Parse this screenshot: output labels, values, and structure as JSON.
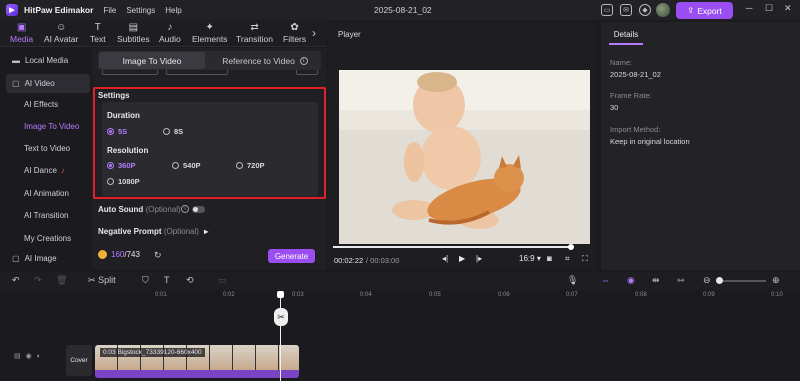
{
  "app": {
    "title": "HitPaw Edimakor",
    "menus": [
      "File",
      "Settings",
      "Help"
    ],
    "project_name": "2025-08-21_02",
    "export_label": "Export"
  },
  "tabs": [
    {
      "label": "Media",
      "icon": "media-icon",
      "active": true
    },
    {
      "label": "AI Avatar",
      "icon": "avatar-icon"
    },
    {
      "label": "Text",
      "icon": "text-icon"
    },
    {
      "label": "Subtitles",
      "icon": "subtitles-icon"
    },
    {
      "label": "Audio",
      "icon": "audio-icon"
    },
    {
      "label": "Elements",
      "icon": "elements-icon"
    },
    {
      "label": "Transition",
      "icon": "transition-icon"
    },
    {
      "label": "Filters",
      "icon": "filters-icon"
    }
  ],
  "sidebar": {
    "items": [
      {
        "label": "Local Media"
      },
      {
        "label": "AI Video"
      },
      {
        "label": "AI Effects"
      },
      {
        "label": "Image To Video"
      },
      {
        "label": "Text to Video"
      },
      {
        "label": "AI Dance"
      },
      {
        "label": "AI Animation"
      },
      {
        "label": "AI Transition"
      },
      {
        "label": "My Creations"
      },
      {
        "label": "AI Image"
      }
    ]
  },
  "panel": {
    "mode_tabs": [
      "Image To Video",
      "Reference to Video"
    ],
    "settings_title": "Settings",
    "duration": {
      "label": "Duration",
      "options": [
        "5S",
        "8S"
      ],
      "selected": "5S"
    },
    "resolution": {
      "label": "Resolution",
      "options": [
        "360P",
        "540P",
        "720P",
        "1080P"
      ],
      "selected": "360P"
    },
    "auto_sound": {
      "label": "Auto Sound",
      "optional": "(Optional)",
      "on": false
    },
    "negative_prompt": {
      "label": "Negative Prompt",
      "optional": "(Optional)"
    },
    "credits": {
      "used": "160",
      "total": "/743"
    },
    "generate_label": "Generate"
  },
  "player": {
    "label": "Player",
    "time_current": "00:02:22",
    "time_total": "/ 00:03:00",
    "progress": 1.0,
    "aspect": "16:9"
  },
  "details": {
    "tab": "Details",
    "fields": [
      {
        "key": "Name:",
        "value": "2025-08-21_02"
      },
      {
        "key": "Frame Rate:",
        "value": "30"
      },
      {
        "key": "Import Method:",
        "value": "Keep in original location"
      }
    ]
  },
  "timeline": {
    "split_label": "Split",
    "ruler_ticks": [
      "0:01",
      "0:02",
      "0:03",
      "0:04",
      "0:05",
      "0:06",
      "0:07",
      "0:08",
      "0:09",
      "0:10"
    ],
    "cover_label": "Cover",
    "clip_label": "0:03 Bigstock_73339120-660x400"
  }
}
